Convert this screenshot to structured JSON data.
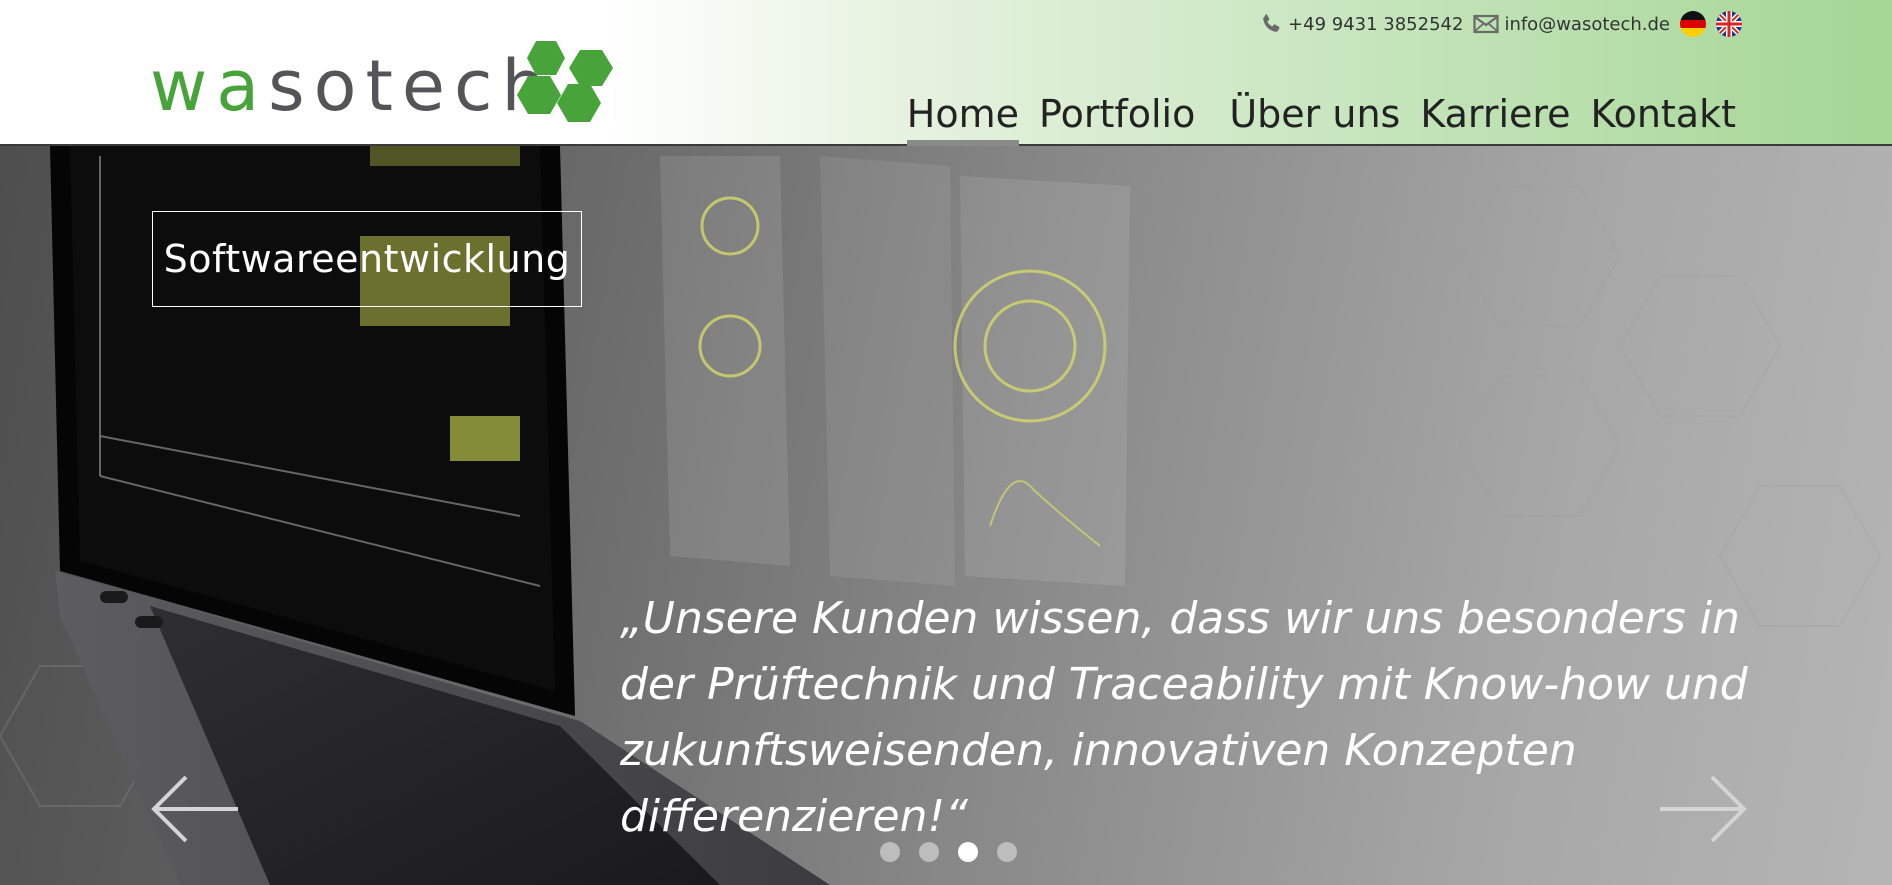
{
  "brand": {
    "logo_text_green_1": "w",
    "logo_text_green_2": "a",
    "logo_text_gray": "sotech",
    "brand_green": "#47a33a",
    "brand_gray": "#555559"
  },
  "contact": {
    "phone": "+49 9431 3852542",
    "email": "info@wasotech.de",
    "phone_icon": "phone-icon",
    "email_icon": "envelope-icon"
  },
  "languages": [
    {
      "code": "de",
      "icon": "flag-germany-icon"
    },
    {
      "code": "en",
      "icon": "flag-uk-icon"
    }
  ],
  "nav": {
    "items": [
      {
        "label": "Home",
        "active": true
      },
      {
        "label": "Portfolio",
        "active": false
      },
      {
        "label": "Über uns",
        "active": false
      },
      {
        "label": "Karriere",
        "active": false
      },
      {
        "label": "Kontakt",
        "active": false
      }
    ]
  },
  "hero": {
    "category": "Softwareentwicklung",
    "quote": "„Unsere Kunden wissen, dass wir uns besonders in der Prüftechnik und Traceability mit Know-how und zukunftsweisenden, innovativen Konzepten differenzieren!“",
    "slide_count": 4,
    "active_slide": 3,
    "prev_icon": "arrow-left-icon",
    "next_icon": "arrow-right-icon"
  }
}
